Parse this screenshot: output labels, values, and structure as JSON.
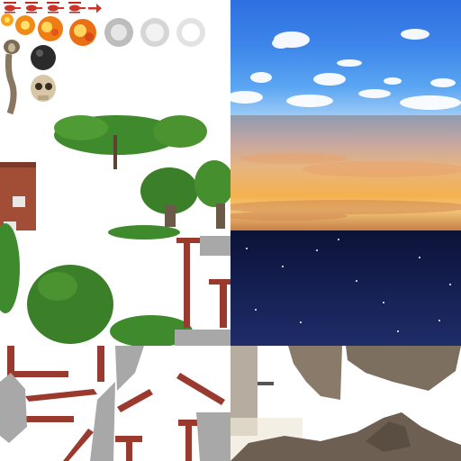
{
  "sheet": {
    "background": "#ffffff",
    "tiles": [
      {
        "name": "helicopter-icon",
        "count": 4
      },
      {
        "name": "right-arrow-icon"
      },
      {
        "name": "explosion-animation",
        "frames": 8
      },
      {
        "name": "cobra-sprite"
      },
      {
        "name": "cannonball-sprite"
      },
      {
        "name": "skull-sprite"
      },
      {
        "name": "jungle-tree-tiles"
      },
      {
        "name": "brick-building-tile"
      },
      {
        "name": "red-steel-girder-tiles"
      },
      {
        "name": "broken-concrete-tiles"
      },
      {
        "name": "daytime-sky-backdrop"
      },
      {
        "name": "sunset-sky-backdrop"
      },
      {
        "name": "night-sky-backdrop"
      },
      {
        "name": "rocky-cliff-tiles"
      }
    ]
  },
  "colors": {
    "girder": "#9a3a2e",
    "foliage": "#3f8a2c",
    "brick": "#a24e36",
    "rock": "#8a7a6a",
    "concrete": "#a8a8a8",
    "sky_day": "#3d86ea",
    "sky_sunset": "#f4b14e",
    "sky_night": "#172257"
  }
}
